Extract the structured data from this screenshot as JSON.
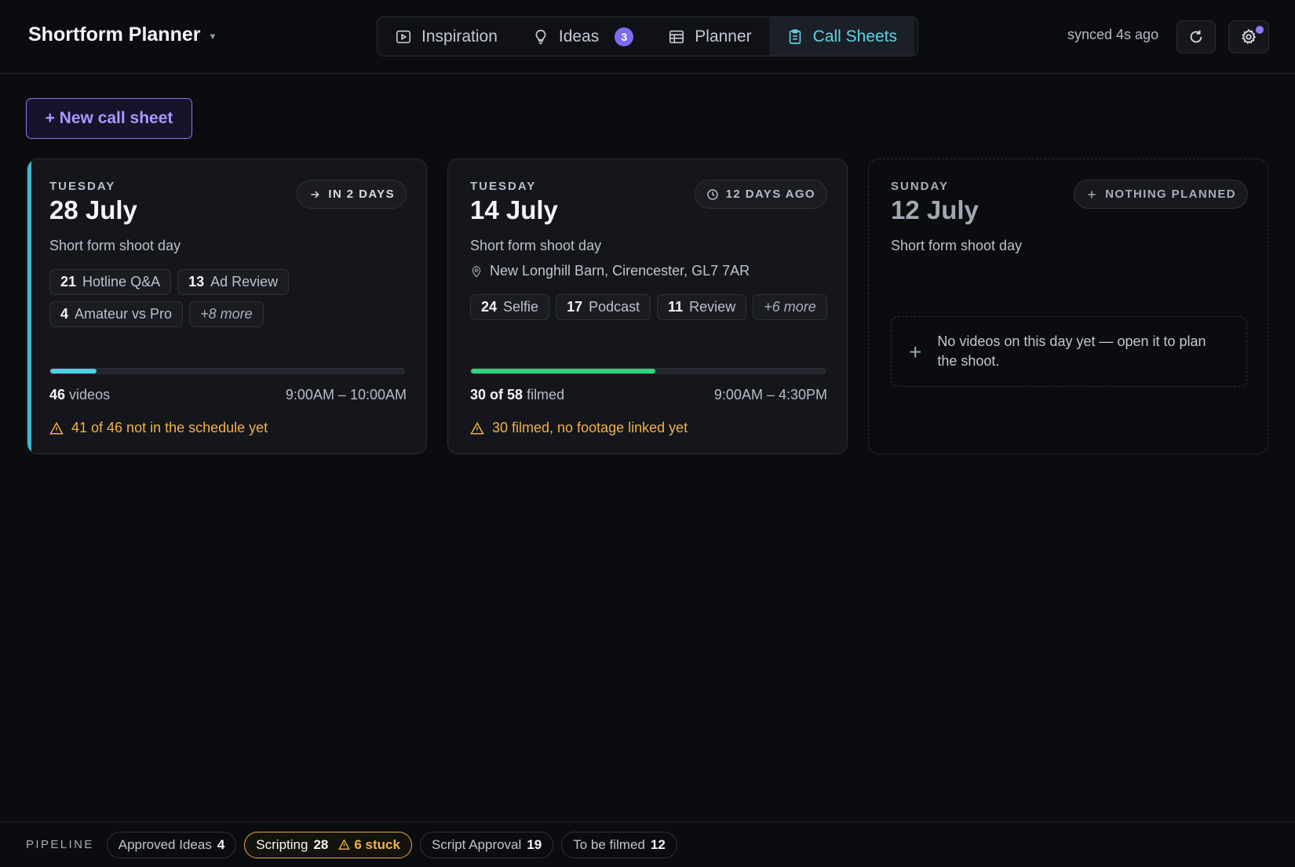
{
  "header": {
    "app_title": "Shortform Planner",
    "tabs": [
      {
        "label": "Inspiration",
        "icon": "play-square-icon"
      },
      {
        "label": "Ideas",
        "icon": "lightbulb-icon",
        "badge": "3"
      },
      {
        "label": "Planner",
        "icon": "table-icon"
      },
      {
        "label": "Call Sheets",
        "icon": "clipboard-icon",
        "active": true
      }
    ],
    "sync_status": "synced 4s ago"
  },
  "new_button_label": "+ New call sheet",
  "cards": [
    {
      "day_of_week": "TUESDAY",
      "date": "28 July",
      "status": "IN 2 DAYS",
      "subtitle": "Short form shoot day",
      "chips": [
        {
          "count": "21",
          "label": "Hotline Q&A"
        },
        {
          "count": "13",
          "label": "Ad Review"
        },
        {
          "count": "4",
          "label": "Amateur vs Pro"
        }
      ],
      "more": "+8 more",
      "progress": 0.13,
      "progress_color": "#4fd0e3",
      "count_bold": "46",
      "count_rest": "videos",
      "time": "9:00AM – 10:00AM",
      "warning": "41 of 46 not in the schedule yet"
    },
    {
      "day_of_week": "TUESDAY",
      "date": "14 July",
      "status": "12 DAYS AGO",
      "subtitle": "Short form shoot day",
      "location": "New Longhill Barn, Cirencester, GL7 7AR",
      "chips": [
        {
          "count": "24",
          "label": "Selfie"
        },
        {
          "count": "17",
          "label": "Podcast"
        },
        {
          "count": "11",
          "label": "Review"
        }
      ],
      "more": "+6 more",
      "progress": 0.52,
      "progress_color": "#34d17f",
      "count_bold": "30 of 58",
      "count_rest": "filmed",
      "time": "9:00AM – 4:30PM",
      "warning": "30 filmed, no footage linked yet"
    },
    {
      "day_of_week": "SUNDAY",
      "date": "12 July",
      "status": "NOTHING PLANNED",
      "subtitle": "Short form shoot day",
      "empty_text": "No videos on this day yet — open it to plan the shoot."
    }
  ],
  "footer": {
    "label": "PIPELINE",
    "stages": [
      {
        "label": "Approved Ideas",
        "count": "4"
      },
      {
        "label": "Scripting",
        "count": "28",
        "stuck": "6 stuck"
      },
      {
        "label": "Script Approval",
        "count": "19"
      },
      {
        "label": "To be filmed",
        "count": "12"
      }
    ]
  },
  "colors": {
    "accent_cyan": "#5fd3e6",
    "accent_purple": "#8b79f3",
    "warning": "#f0b14a",
    "success": "#34d17f"
  }
}
